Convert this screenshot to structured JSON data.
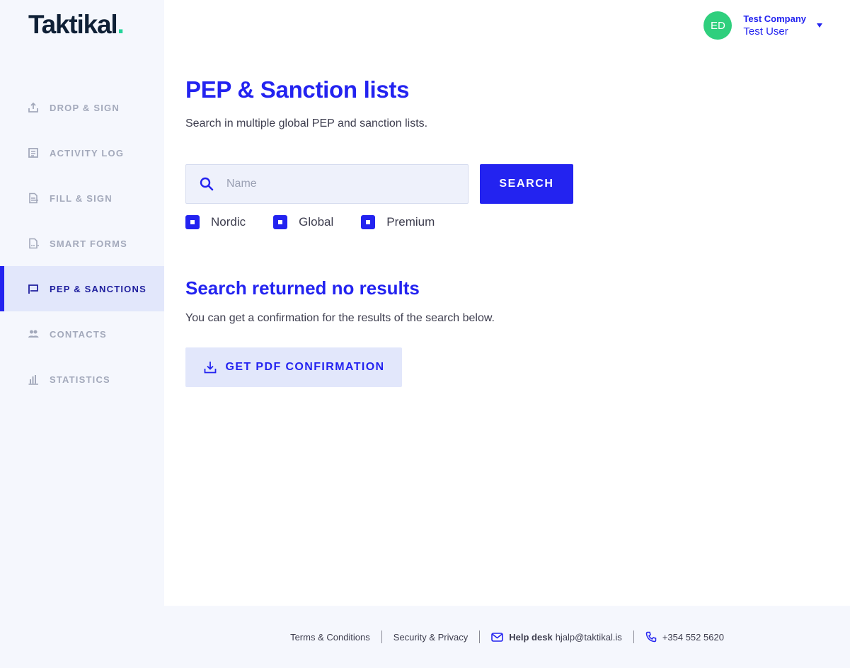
{
  "logo": {
    "text": "Taktikal",
    "dot": "."
  },
  "sidebar": {
    "items": [
      {
        "label": "DROP & SIGN",
        "icon": "upload-icon",
        "active": false
      },
      {
        "label": "ACTIVITY LOG",
        "icon": "list-icon",
        "active": false
      },
      {
        "label": "FILL & SIGN",
        "icon": "document-sign-icon",
        "active": false
      },
      {
        "label": "SMART FORMS",
        "icon": "smart-form-icon",
        "active": false
      },
      {
        "label": "PEP & SANCTIONS",
        "icon": "flag-icon",
        "active": true
      },
      {
        "label": "CONTACTS",
        "icon": "people-icon",
        "active": false
      },
      {
        "label": "STATISTICS",
        "icon": "bar-chart-icon",
        "active": false
      }
    ]
  },
  "user": {
    "initials": "ED",
    "company": "Test Company",
    "name": "Test User"
  },
  "main": {
    "title": "PEP & Sanction lists",
    "subtitle": "Search in multiple global PEP and sanction lists.",
    "search": {
      "placeholder": "Name",
      "value": ""
    },
    "search_button": "SEARCH",
    "filters": [
      {
        "label": "Nordic",
        "checked": true
      },
      {
        "label": "Global",
        "checked": true
      },
      {
        "label": "Premium",
        "checked": true
      }
    ],
    "results_title": "Search returned no results",
    "results_text": "You can get a confirmation for the results of the search below.",
    "pdf_button": "GET PDF CONFIRMATION"
  },
  "footer": {
    "terms": "Terms & Conditions",
    "security": "Security & Privacy",
    "helpdesk_label": "Help desk",
    "helpdesk_email": "hjalp@taktikal.is",
    "phone": "+354 552 5620"
  },
  "colors": {
    "primary": "#2323f0",
    "brand_dot": "#23d49a",
    "avatar": "#2fcf7d",
    "sidebar_bg": "#f5f7fd",
    "active_bg": "#e2e7fb",
    "muted": "#a3a9bb"
  }
}
